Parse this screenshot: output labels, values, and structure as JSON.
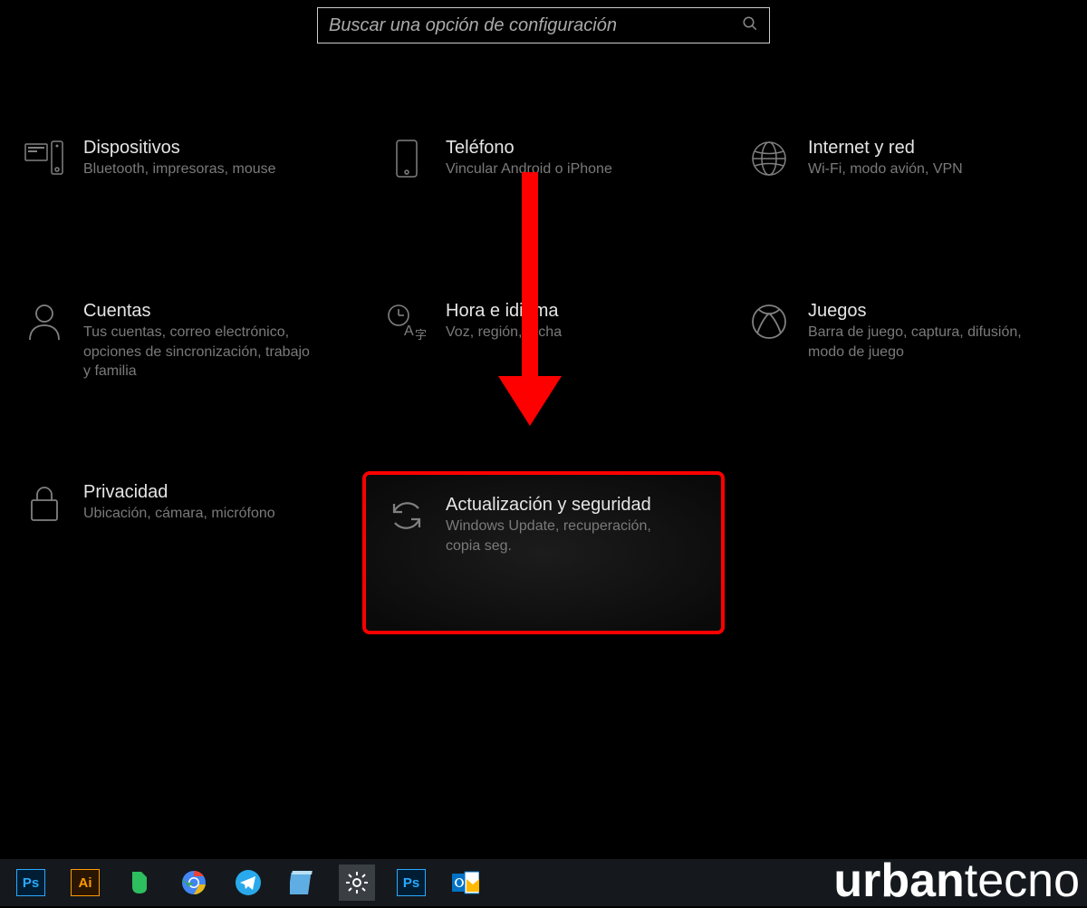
{
  "search": {
    "placeholder": "Buscar una opción de configuración"
  },
  "tiles": {
    "devices": {
      "title": "Dispositivos",
      "desc": "Bluetooth, impresoras, mouse"
    },
    "phone": {
      "title": "Teléfono",
      "desc": "Vincular Android o iPhone"
    },
    "network": {
      "title": "Internet y red",
      "desc": "Wi-Fi, modo avión, VPN"
    },
    "accounts": {
      "title": "Cuentas",
      "desc": "Tus cuentas, correo electrónico, opciones de sincronización, trabajo y familia"
    },
    "time": {
      "title": "Hora e idioma",
      "desc": "Voz, región, fecha"
    },
    "gaming": {
      "title": "Juegos",
      "desc": "Barra de juego, captura, difusión, modo de juego"
    },
    "privacy": {
      "title": "Privacidad",
      "desc": "Ubicación, cámara, micrófono"
    },
    "update": {
      "title": "Actualización y seguridad",
      "desc": "Windows Update, recuperación, copia seg."
    }
  },
  "taskbar_icons": {
    "ps": "Ps",
    "ai": "Ai"
  },
  "watermark": {
    "brand_bold": "urban",
    "brand_rest": "tecno"
  }
}
